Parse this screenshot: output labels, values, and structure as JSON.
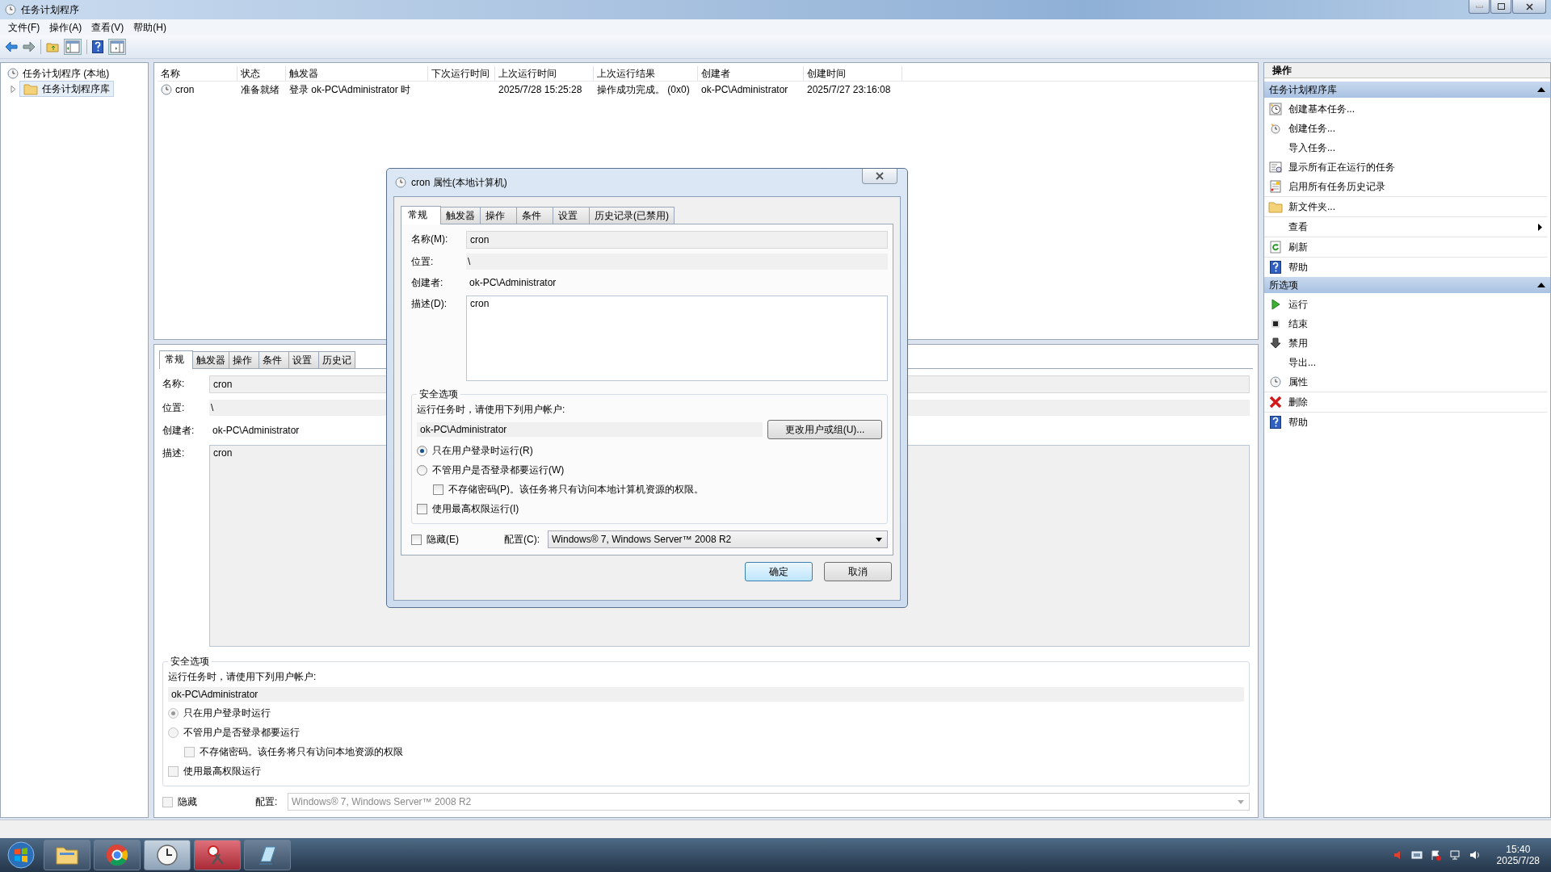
{
  "window": {
    "title": "任务计划程序"
  },
  "menu": [
    "文件(F)",
    "操作(A)",
    "查看(V)",
    "帮助(H)"
  ],
  "tree": [
    {
      "label": "任务计划程序 (本地)",
      "selected": false,
      "children": [
        {
          "label": "任务计划程序库",
          "selected": true,
          "expanded": false
        }
      ]
    }
  ],
  "task_list": {
    "columns": [
      "名称",
      "状态",
      "触发器",
      "下次运行时间",
      "上次运行时间",
      "上次运行结果",
      "创建者",
      "创建时间"
    ],
    "rows": [
      {
        "cells": [
          "cron",
          "准备就绪",
          "登录 ok-PC\\Administrator 时",
          "",
          "2025/7/28 15:25:28",
          "操作成功完成。 (0x0)",
          "ok-PC\\Administrator",
          "2025/7/27 23:16:08"
        ]
      }
    ]
  },
  "detail": {
    "disabled": true,
    "tabs": [
      {
        "label": "常规",
        "selected": true
      },
      {
        "label": "触发器",
        "selected": false
      },
      {
        "label": "操作",
        "selected": false
      },
      {
        "label": "条件",
        "selected": false
      },
      {
        "label": "设置",
        "selected": false
      },
      {
        "label": "历史记",
        "selected": false
      }
    ],
    "fields": [
      {
        "kind": "input",
        "label": "名称:",
        "value": "cron"
      },
      {
        "kind": "readonly",
        "label": "位置:",
        "value": "\\"
      },
      {
        "kind": "text",
        "label": "创建者:",
        "value": "ok-PC\\Administrator"
      },
      {
        "kind": "textarea",
        "label": "描述:",
        "value": "cron"
      }
    ],
    "security": {
      "legend": "安全选项",
      "prompt": "运行任务时，请使用下列用户帐户:",
      "account": "ok-PC\\Administrator",
      "options": [
        {
          "kind": "radio",
          "label": "只在用户登录时运行",
          "checked": true
        },
        {
          "kind": "radio",
          "label": "不管用户是否登录都要运行",
          "checked": false
        },
        {
          "kind": "subcheck",
          "label": "不存储密码。该任务将只有访问本地资源的权限",
          "checked": false
        },
        {
          "kind": "check",
          "label": "使用最高权限运行",
          "checked": false
        }
      ]
    },
    "hidden": {
      "label": "隐藏",
      "checked": false
    },
    "config_label": "配置:",
    "config": "Windows® 7, Windows Server™ 2008 R2"
  },
  "dialog": {
    "title": "cron 属性(本地计算机)",
    "disabled": false,
    "tabs": [
      {
        "label": "常规",
        "selected": true
      },
      {
        "label": "触发器",
        "selected": false
      },
      {
        "label": "操作",
        "selected": false
      },
      {
        "label": "条件",
        "selected": false
      },
      {
        "label": "设置",
        "selected": false
      },
      {
        "label": "历史记录(已禁用)",
        "selected": false
      }
    ],
    "fields": [
      {
        "kind": "input",
        "label": "名称(M):",
        "value": "cron"
      },
      {
        "kind": "readonly",
        "label": "位置:",
        "value": "\\"
      },
      {
        "kind": "text",
        "label": "创建者:",
        "value": "ok-PC\\Administrator"
      },
      {
        "kind": "textarea",
        "label": "描述(D):",
        "value": "cron"
      }
    ],
    "security": {
      "legend": "安全选项",
      "prompt": "运行任务时，请使用下列用户帐户:",
      "account": "ok-PC\\Administrator",
      "change_button": "更改用户或组(U)...",
      "options": [
        {
          "kind": "radio",
          "label": "只在用户登录时运行(R)",
          "checked": true
        },
        {
          "kind": "radio",
          "label": "不管用户是否登录都要运行(W)",
          "checked": false
        },
        {
          "kind": "subcheck",
          "label": "不存储密码(P)。该任务将只有访问本地计算机资源的权限。",
          "checked": false
        },
        {
          "kind": "check",
          "label": "使用最高权限运行(I)",
          "checked": false
        }
      ]
    },
    "hidden": {
      "label": "隐藏(E)",
      "checked": false
    },
    "config_label": "配置(C):",
    "config": "Windows® 7, Windows Server™ 2008 R2",
    "buttons": [
      {
        "label": "确定",
        "default": true
      },
      {
        "label": "取消",
        "default": false
      }
    ]
  },
  "actions": {
    "title": "操作",
    "sections": [
      {
        "title": "任务计划程序库",
        "expanded": true,
        "items": [
          {
            "label": "创建基本任务...",
            "separator": false,
            "submenu": false
          },
          {
            "label": "创建任务...",
            "separator": false,
            "submenu": false
          },
          {
            "label": "导入任务...",
            "separator": false,
            "submenu": false
          },
          {
            "label": "显示所有正在运行的任务",
            "separator": false,
            "submenu": false
          },
          {
            "label": "启用所有任务历史记录",
            "separator": true,
            "submenu": false
          },
          {
            "label": "新文件夹...",
            "separator": true,
            "submenu": false
          },
          {
            "label": "查看",
            "separator": true,
            "submenu": true
          },
          {
            "label": "刷新",
            "separator": true,
            "submenu": false
          },
          {
            "label": "帮助",
            "separator": false,
            "submenu": false
          }
        ]
      },
      {
        "title": "所选项",
        "expanded": true,
        "items": [
          {
            "label": "运行",
            "separator": false,
            "submenu": false
          },
          {
            "label": "结束",
            "separator": false,
            "submenu": false
          },
          {
            "label": "禁用",
            "separator": false,
            "submenu": false
          },
          {
            "label": "导出...",
            "separator": false,
            "submenu": false
          },
          {
            "label": "属性",
            "separator": true,
            "submenu": false
          },
          {
            "label": "删除",
            "separator": true,
            "submenu": false
          },
          {
            "label": "帮助",
            "separator": false,
            "submenu": false
          }
        ]
      }
    ]
  },
  "taskbar": {
    "apps": [
      {
        "active": false,
        "flashing": false
      },
      {
        "active": false,
        "flashing": false
      },
      {
        "active": true,
        "flashing": false
      },
      {
        "active": false,
        "flashing": true
      },
      {
        "active": false,
        "flashing": false
      }
    ],
    "time": "15:40",
    "date": "2025/7/28"
  }
}
